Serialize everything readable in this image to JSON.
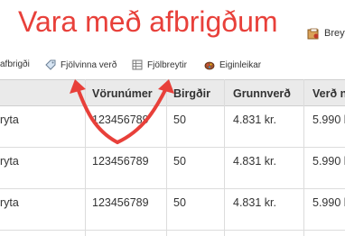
{
  "page": {
    "title": "Vara með afbrigðum",
    "right_button": "Breyt"
  },
  "toolbar": {
    "items": [
      {
        "label": "afbrigði"
      },
      {
        "label": "Fjölvinna verð"
      },
      {
        "label": "Fjölbreytir"
      },
      {
        "label": "Eiginleikar"
      }
    ]
  },
  "table": {
    "columns": [
      "",
      "Vörunúmer",
      "Birgðir",
      "Grunnverð",
      "Verð n"
    ],
    "rows": [
      [
        "ryta",
        "123456789",
        "50",
        "4.831 kr.",
        "5.990 k"
      ],
      [
        "ryta",
        "123456789",
        "50",
        "4.831 kr.",
        "5.990 k"
      ],
      [
        "ryta",
        "123456789",
        "50",
        "4.831 kr.",
        "5.990 k"
      ]
    ]
  },
  "colors": {
    "title": "#e8403a",
    "arrow": "#e8403a",
    "header_bg": "#eaeaea"
  }
}
